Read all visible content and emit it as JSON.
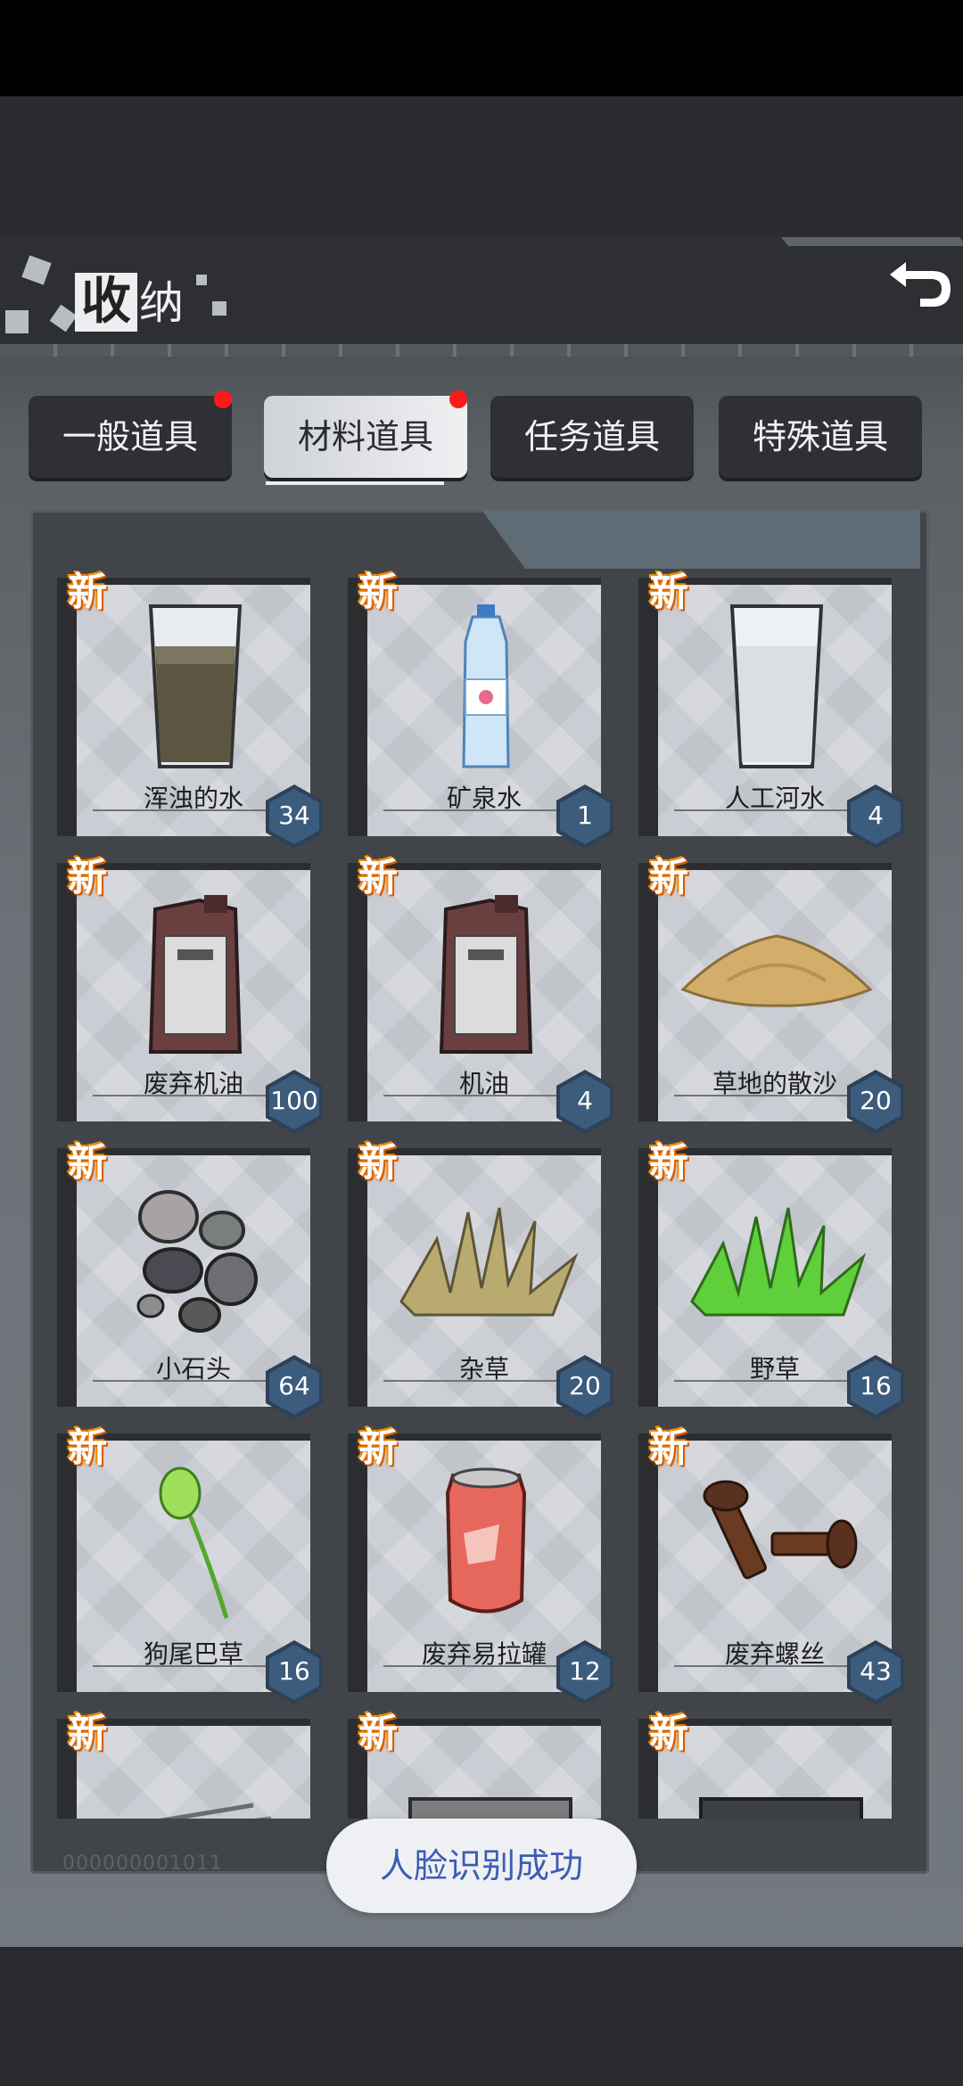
{
  "title": {
    "main": "收",
    "rest": "纳"
  },
  "tabs": [
    {
      "label": "一般道具",
      "dot": true
    },
    {
      "label": "材料道具",
      "dot": true,
      "active": true
    },
    {
      "label": "任务道具",
      "dot": false
    },
    {
      "label": "特殊道具",
      "dot": false
    }
  ],
  "new_label": "新",
  "items": [
    {
      "name": "浑浊的水",
      "count": "34",
      "icon": "murky-water-glass-icon"
    },
    {
      "name": "矿泉水",
      "count": "1",
      "icon": "water-bottle-icon"
    },
    {
      "name": "人工河水",
      "count": "4",
      "icon": "water-glass-icon"
    },
    {
      "name": "废弃机油",
      "count": "100",
      "icon": "oil-can-icon"
    },
    {
      "name": "机油",
      "count": "4",
      "icon": "oil-can-icon"
    },
    {
      "name": "草地的散沙",
      "count": "20",
      "icon": "sand-pile-icon"
    },
    {
      "name": "小石头",
      "count": "64",
      "icon": "stones-icon"
    },
    {
      "name": "杂草",
      "count": "20",
      "icon": "dry-grass-icon"
    },
    {
      "name": "野草",
      "count": "16",
      "icon": "green-grass-icon"
    },
    {
      "name": "狗尾巴草",
      "count": "16",
      "icon": "foxtail-grass-icon"
    },
    {
      "name": "废弃易拉罐",
      "count": "12",
      "icon": "soda-can-icon"
    },
    {
      "name": "废弃螺丝",
      "count": "43",
      "icon": "screws-icon"
    },
    {
      "name": "",
      "count": "",
      "icon": "nails-icon"
    },
    {
      "name": "",
      "count": "",
      "icon": "metal-pipe-icon"
    },
    {
      "name": "",
      "count": "",
      "icon": "metal-plate-icon"
    }
  ],
  "footer_id": "000000001011",
  "toast": "人脸识别成功",
  "colors": {
    "new_badge": "#ff8a00",
    "count_badge": "#3c5c7d",
    "notify_dot": "#ff1a1a",
    "toast_text": "#3c5cb5"
  }
}
